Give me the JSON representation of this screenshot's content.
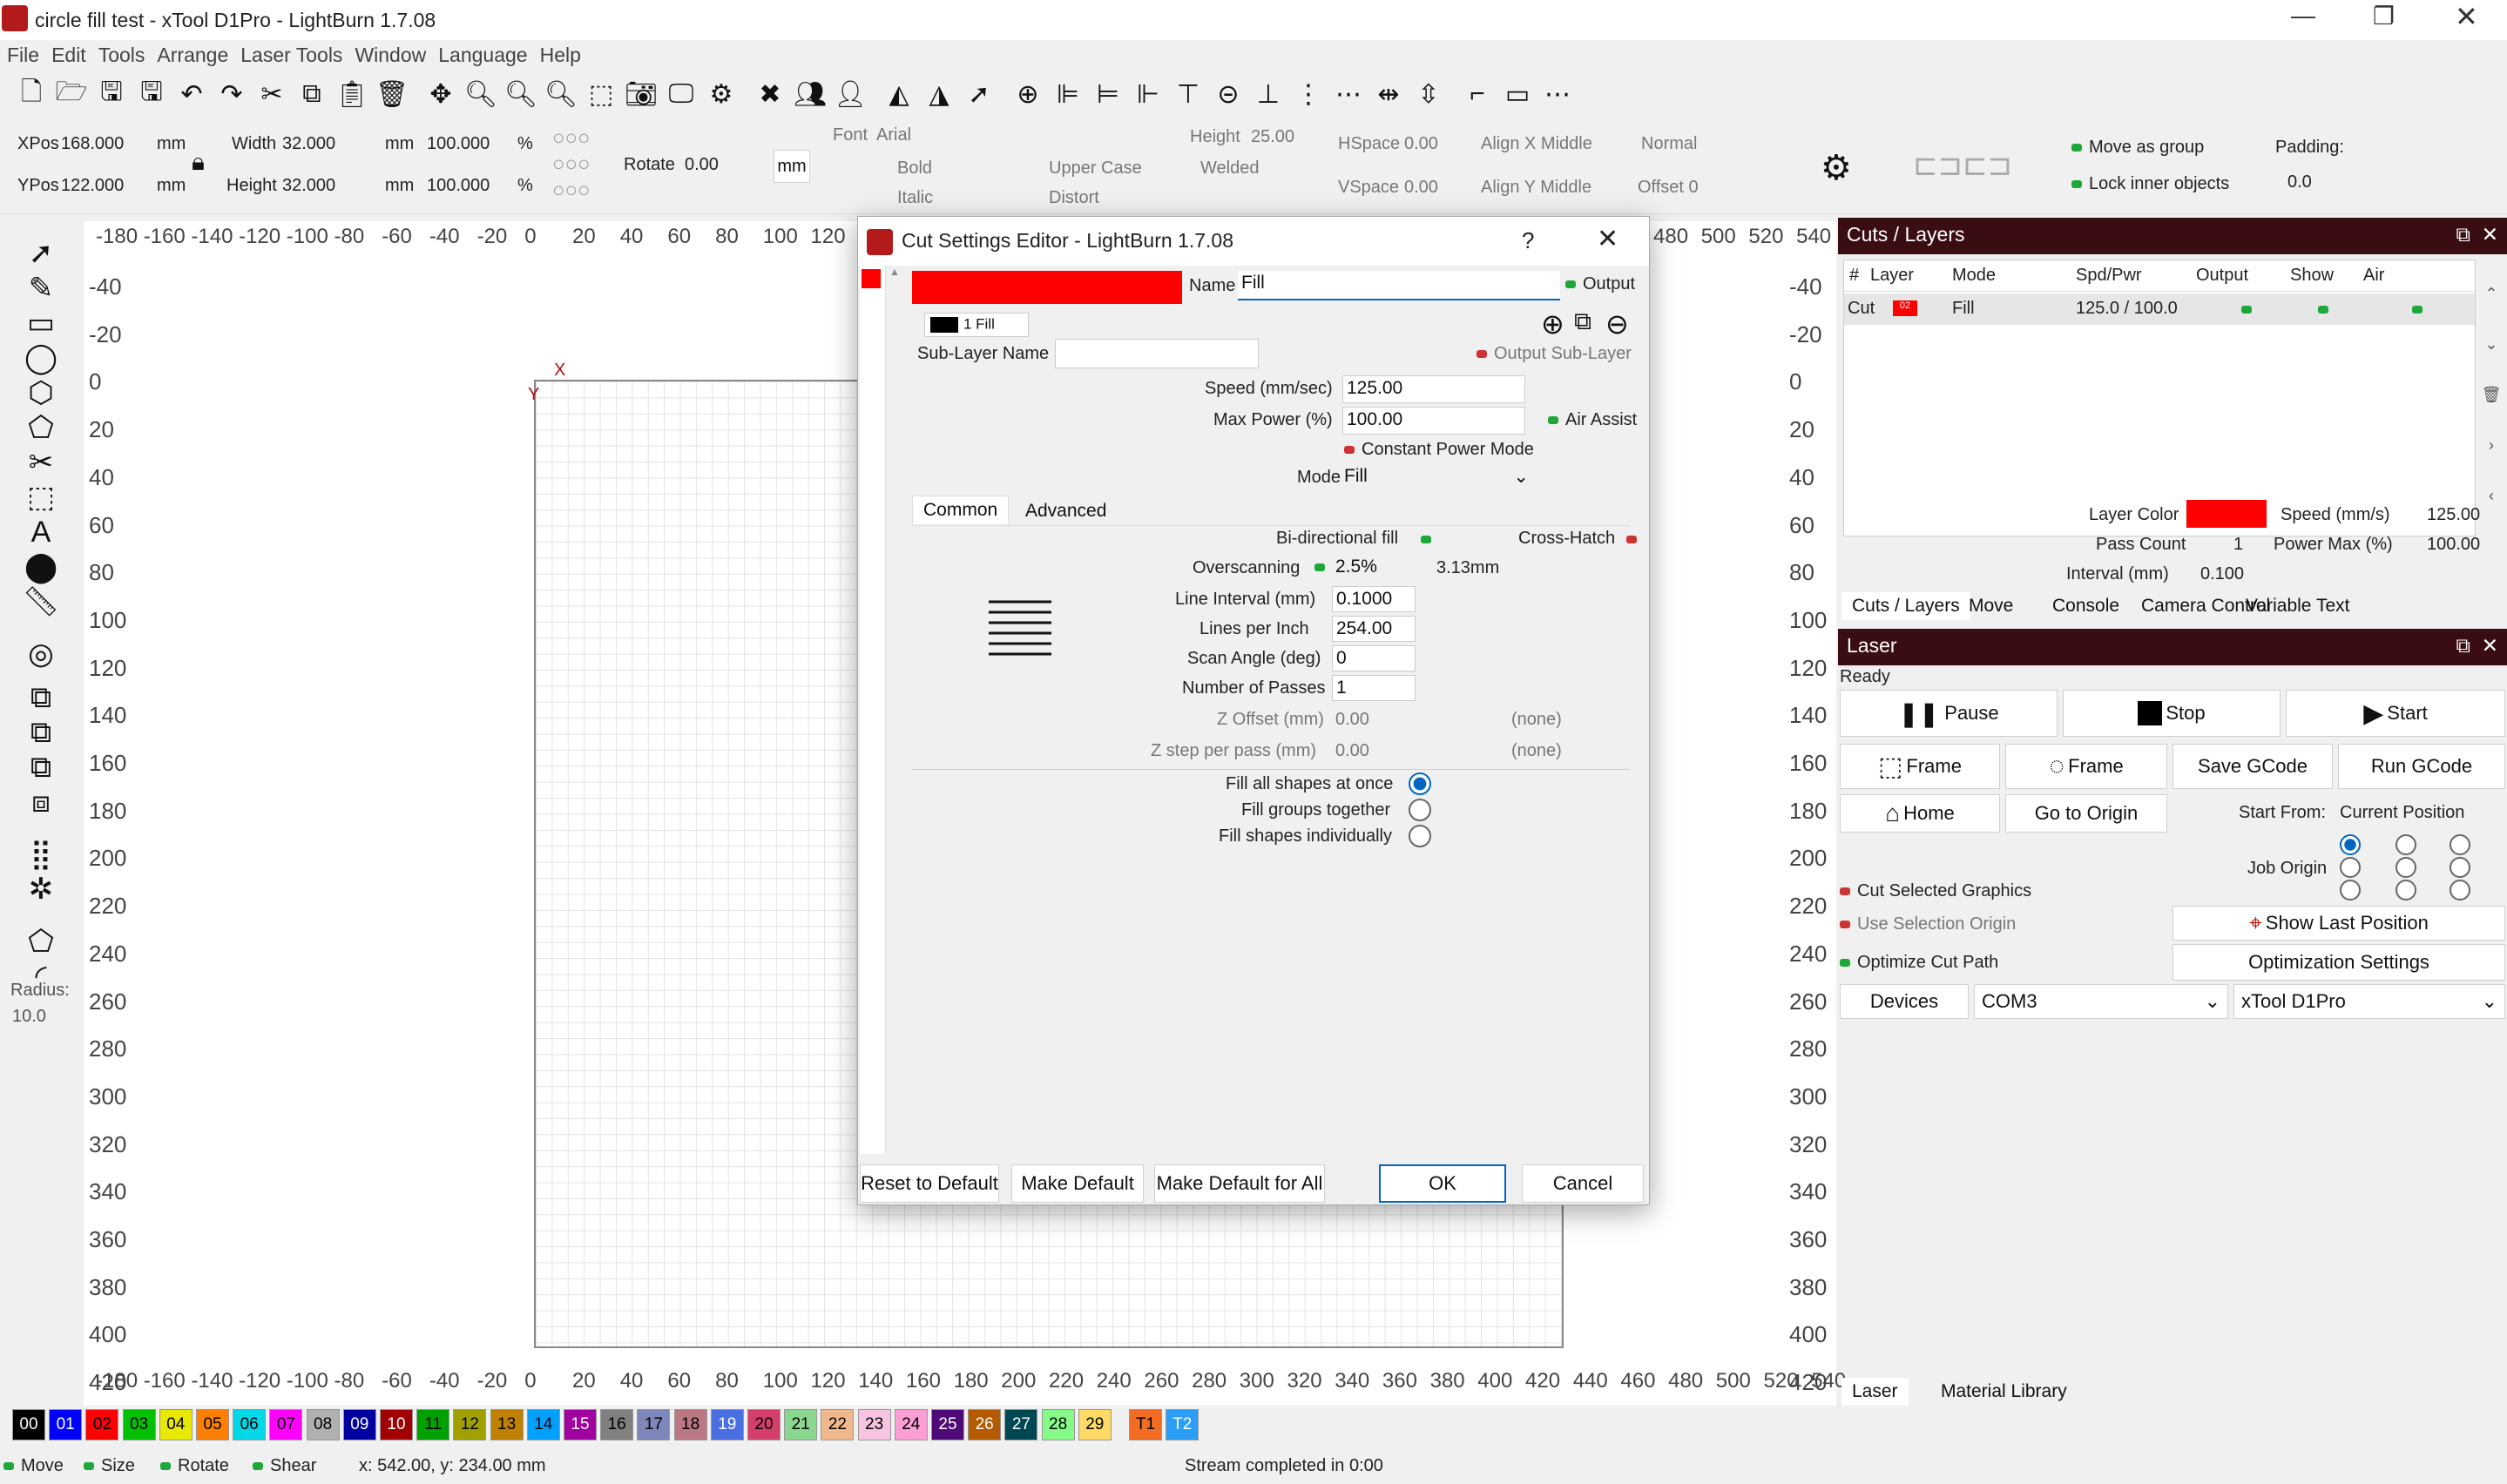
{
  "window": {
    "title": "circle fill test - xTool D1Pro - LightBurn 1.7.08"
  },
  "menu": [
    "File",
    "Edit",
    "Tools",
    "Arrange",
    "Laser Tools",
    "Window",
    "Language",
    "Help"
  ],
  "props": {
    "xpos_label": "XPos",
    "xpos": "168.000",
    "ypos_label": "YPos",
    "ypos": "122.000",
    "unit": "mm",
    "width_label": "Width",
    "width": "32.000",
    "height_label": "Height",
    "height": "32.000",
    "scale_w": "100.000",
    "scale_h": "100.000",
    "pct": "%",
    "rotate_label": "Rotate",
    "rotate": "0.00",
    "unit_button": "mm",
    "font_label": "Font",
    "font": "Arial",
    "bold": "Bold",
    "italic": "Italic",
    "upper_case": "Upper Case",
    "distort": "Distort",
    "welded": "Welded",
    "font_height_label": "Height",
    "font_height": "25.00",
    "hspace_label": "HSpace",
    "hspace": "0.00",
    "vspace_label": "VSpace",
    "vspace": "0.00",
    "align_x": "Align X Middle",
    "align_y": "Align Y Middle",
    "normal": "Normal",
    "offset": "Offset 0",
    "move_as_group": "Move as group",
    "lock_inner": "Lock inner objects",
    "padding_label": "Padding:",
    "padding": "0.0"
  },
  "rulers": {
    "h_top": [
      "-180",
      "-160",
      "-140",
      "-120",
      "-100",
      "-80",
      "-60",
      "-40",
      "-20",
      "0",
      "20",
      "40",
      "60",
      "80",
      "100",
      "120"
    ],
    "h_top_right": [
      "480",
      "500",
      "520",
      "540"
    ],
    "h_bottom": [
      "-180",
      "-160",
      "-140",
      "-120",
      "-100",
      "-80",
      "-60",
      "-40",
      "-20",
      "0",
      "20",
      "40",
      "60",
      "80",
      "100",
      "120",
      "140",
      "160",
      "180",
      "200",
      "220",
      "240",
      "260",
      "280",
      "300",
      "320",
      "340",
      "360",
      "380",
      "400",
      "420",
      "440",
      "460",
      "480",
      "500",
      "520",
      "540"
    ],
    "v": [
      "-40",
      "-20",
      "0",
      "20",
      "40",
      "60",
      "80",
      "100",
      "120",
      "140",
      "160",
      "180",
      "200",
      "220",
      "240",
      "260",
      "280",
      "300",
      "320",
      "340",
      "360",
      "380",
      "400",
      "420"
    ]
  },
  "left_tools": {
    "radius_label": "Radius:",
    "radius": "10.0"
  },
  "palette": [
    {
      "t": "00",
      "c": "#000000",
      "f": "#ffffff"
    },
    {
      "t": "01",
      "c": "#0000ff",
      "f": "#ffffff"
    },
    {
      "t": "02",
      "c": "#ff0000",
      "f": "#000000"
    },
    {
      "t": "03",
      "c": "#00c000",
      "f": "#000000"
    },
    {
      "t": "04",
      "c": "#e8e800",
      "f": "#000000"
    },
    {
      "t": "05",
      "c": "#ff8000",
      "f": "#000000"
    },
    {
      "t": "06",
      "c": "#00d8e8",
      "f": "#000000"
    },
    {
      "t": "07",
      "c": "#ff00ff",
      "f": "#000000"
    },
    {
      "t": "08",
      "c": "#b0b0b0",
      "f": "#000000"
    },
    {
      "t": "09",
      "c": "#0000a0",
      "f": "#ffffff"
    },
    {
      "t": "10",
      "c": "#a00000",
      "f": "#ffffff"
    },
    {
      "t": "11",
      "c": "#00a000",
      "f": "#000000"
    },
    {
      "t": "12",
      "c": "#a0a000",
      "f": "#000000"
    },
    {
      "t": "13",
      "c": "#c08000",
      "f": "#000000"
    },
    {
      "t": "14",
      "c": "#00a0ff",
      "f": "#000000"
    },
    {
      "t": "15",
      "c": "#a000a0",
      "f": "#ffffff"
    },
    {
      "t": "16",
      "c": "#808080",
      "f": "#000000"
    },
    {
      "t": "17",
      "c": "#7d87b9",
      "f": "#000000"
    },
    {
      "t": "18",
      "c": "#bb7784",
      "f": "#000000"
    },
    {
      "t": "19",
      "c": "#4a6fe3",
      "f": "#ffffff"
    },
    {
      "t": "20",
      "c": "#d33f6a",
      "f": "#000000"
    },
    {
      "t": "21",
      "c": "#8cd78f",
      "f": "#000000"
    },
    {
      "t": "22",
      "c": "#f0b98d",
      "f": "#000000"
    },
    {
      "t": "23",
      "c": "#f6c4e1",
      "f": "#000000"
    },
    {
      "t": "24",
      "c": "#fa9ed4",
      "f": "#000000"
    },
    {
      "t": "25",
      "c": "#500a78",
      "f": "#ffffff"
    },
    {
      "t": "26",
      "c": "#b45a00",
      "f": "#ffffff"
    },
    {
      "t": "27",
      "c": "#004754",
      "f": "#ffffff"
    },
    {
      "t": "28",
      "c": "#86fa88",
      "f": "#000000"
    },
    {
      "t": "29",
      "c": "#ffdb66",
      "f": "#000000"
    },
    {
      "t": "T1",
      "c": "#f36c24",
      "f": "#000000"
    },
    {
      "t": "T2",
      "c": "#2a9df4",
      "f": "#ffffff"
    }
  ],
  "status": {
    "move": "Move",
    "size": "Size",
    "rotate": "Rotate",
    "shear": "Shear",
    "coords": "x: 542.00, y: 234.00 mm",
    "stream": "Stream completed in 0:00"
  },
  "cuts_panel": {
    "title": "Cuts / Layers",
    "headers": [
      "#",
      "Layer",
      "Mode",
      "Spd/Pwr",
      "Output",
      "Show",
      "Air"
    ],
    "row": {
      "num": "Cut",
      "layer": "02",
      "mode": "Fill",
      "spdpwr": "125.0 / 100.0"
    },
    "layer_color_label": "Layer Color",
    "pass_count_label": "Pass Count",
    "pass_count": "1",
    "interval_label": "Interval (mm)",
    "interval": "0.100",
    "speed_label": "Speed (mm/s)",
    "speed": "125.00",
    "power_label": "Power Max (%)",
    "power": "100.00",
    "tabs": [
      "Cuts / Layers",
      "Move",
      "Console",
      "Camera Control",
      "Variable Text"
    ]
  },
  "laser_panel": {
    "title": "Laser",
    "status": "Ready",
    "pause": "Pause",
    "stop": "Stop",
    "start": "Start",
    "frame1": "Frame",
    "frame2": "Frame",
    "save_gcode": "Save GCode",
    "run_gcode": "Run GCode",
    "home": "Home",
    "go_origin": "Go to Origin",
    "start_from_label": "Start From:",
    "start_from": "Current Position",
    "job_origin": "Job Origin",
    "cut_selected": "Cut Selected Graphics",
    "use_selection_origin": "Use Selection Origin",
    "show_last_position": "Show Last Position",
    "optimize": "Optimize Cut Path",
    "optimization_settings": "Optimization Settings",
    "devices": "Devices",
    "port": "COM3",
    "device": "xTool D1Pro",
    "tabs": [
      "Laser",
      "Material Library"
    ]
  },
  "dialog": {
    "title": "Cut Settings Editor - LightBurn 1.7.08",
    "help": "?",
    "close": "✕",
    "layer_color": "#ff0000",
    "name_label": "Name",
    "name": "Fill",
    "output": "Output",
    "sublayer_tab": "1 Fill",
    "sublayer_name_label": "Sub-Layer Name",
    "sublayer_name": "",
    "output_sublayer": "Output Sub-Layer",
    "speed_label": "Speed (mm/sec)",
    "speed": "125.00",
    "maxpower_label": "Max Power (%)",
    "maxpower": "100.00",
    "air_assist": "Air Assist",
    "constant_power": "Constant Power Mode",
    "mode_label": "Mode",
    "mode": "Fill",
    "tab_common": "Common",
    "tab_advanced": "Advanced",
    "bidirectional": "Bi-directional fill",
    "crosshatch": "Cross-Hatch",
    "overscan_label": "Overscanning",
    "overscan": "2.5%",
    "overscan_mm": "3.13mm",
    "interval_label": "Line Interval (mm)",
    "interval": "0.1000",
    "lpi_label": "Lines per Inch",
    "lpi": "254.00",
    "angle_label": "Scan Angle (deg)",
    "angle": "0",
    "passes_label": "Number of Passes",
    "passes": "1",
    "zoffset_label": "Z Offset (mm)",
    "zoffset": "0.00",
    "zstep_label": "Z step per pass (mm)",
    "zstep": "0.00",
    "none": "(none)",
    "fill_all": "Fill all shapes at once",
    "fill_groups": "Fill groups together",
    "fill_individually": "Fill shapes individually",
    "reset_default": "Reset to Default",
    "make_default": "Make Default",
    "make_default_all": "Make Default for All",
    "ok": "OK",
    "cancel": "Cancel"
  }
}
